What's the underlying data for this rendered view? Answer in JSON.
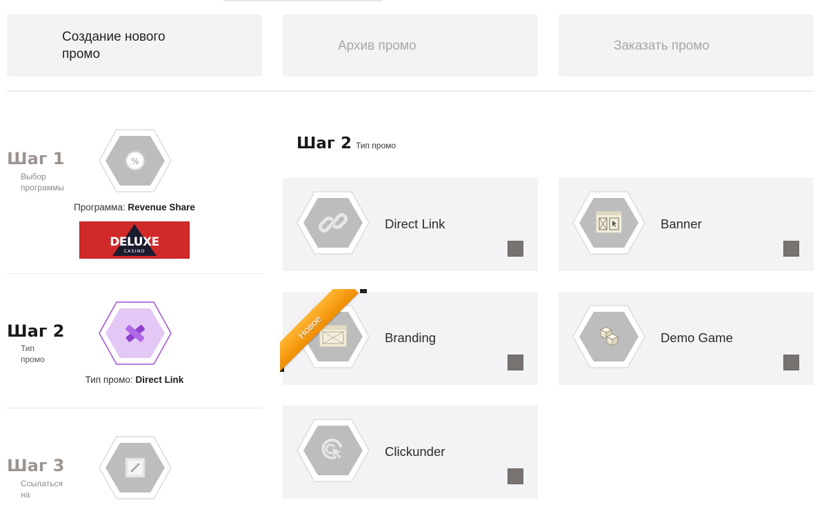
{
  "tabs": {
    "create": "Создание нового промо",
    "archive": "Архив промо",
    "order": "Заказать промо"
  },
  "steps": [
    {
      "title": "Шаг 1",
      "subtitle": "Выбор программы",
      "caption_label": "Программа:",
      "caption_value": "Revenue Share",
      "icon": "percent-badge-icon",
      "logo_text": "DELUXE",
      "logo_subtext": "CASINO"
    },
    {
      "title": "Шаг 2",
      "subtitle": "Тип промо",
      "caption_label": "Тип промо:",
      "caption_value": "Direct Link",
      "icon": "direct-link-icon"
    },
    {
      "title": "Шаг 3",
      "subtitle": "Ссылаться на",
      "icon": "link-square-icon"
    }
  ],
  "main": {
    "title": "Шаг 2",
    "subtitle": "Тип промо",
    "cards": [
      {
        "label": "Direct Link",
        "icon": "link-icon"
      },
      {
        "label": "Banner",
        "icon": "banner-icon"
      },
      {
        "label": "Branding",
        "icon": "branding-icon",
        "badge": "Новое"
      },
      {
        "label": "Demo Game",
        "icon": "cubes-icon"
      },
      {
        "label": "Clickunder",
        "icon": "cursor-click-icon"
      }
    ]
  },
  "colors": {
    "card_bg": "#f3f3f5",
    "hex_gray": "#bdbdbd",
    "hex_active": "#e3c8f5",
    "active_icon": "#9a4fd6",
    "checkbox": "#787270",
    "ribbon": "#f5a11a",
    "logo_bg": "#d02a2a"
  }
}
